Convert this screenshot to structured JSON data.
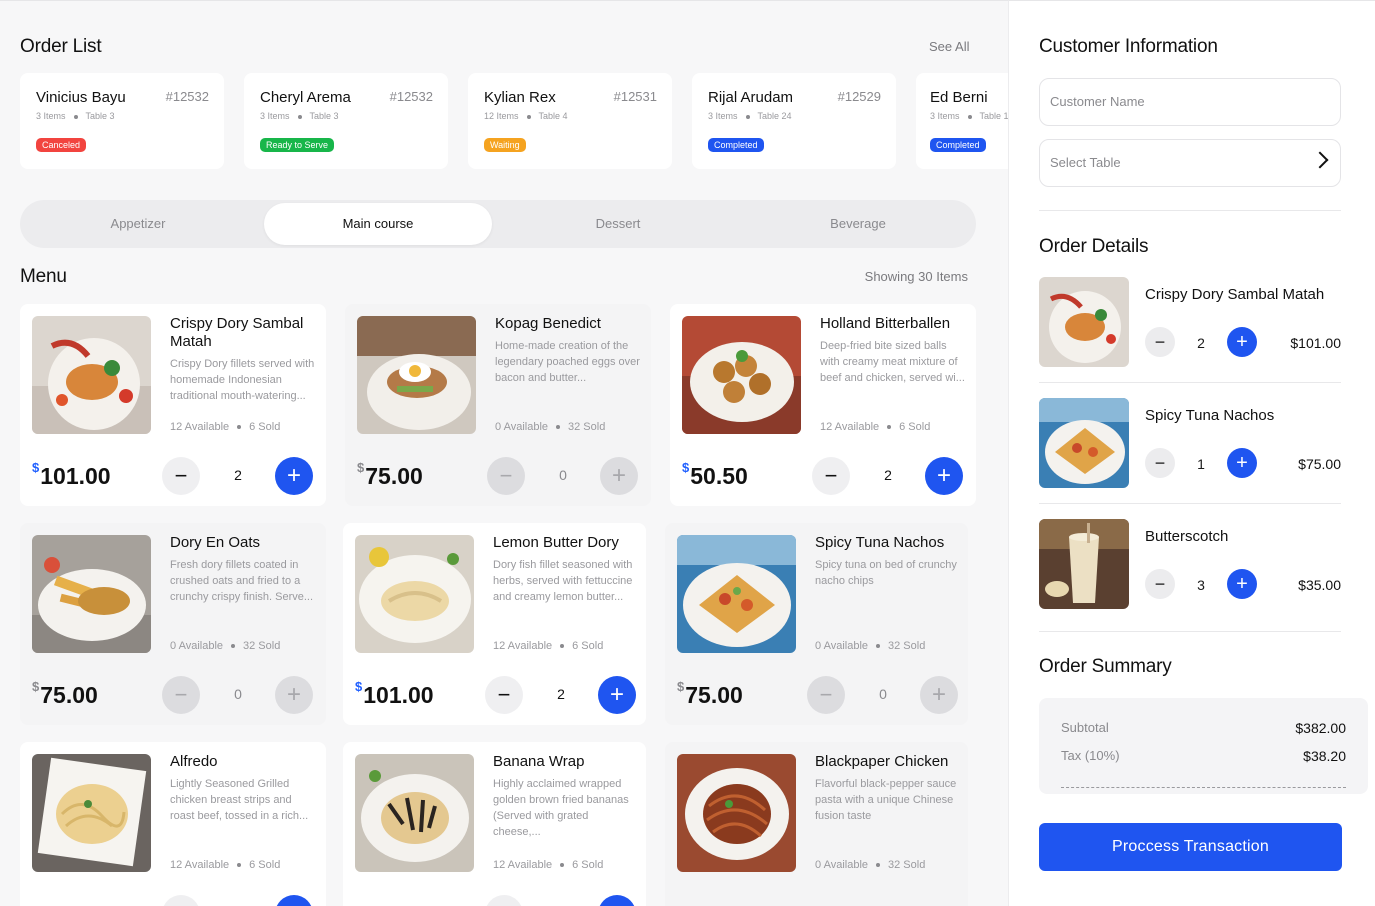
{
  "orders": {
    "title": "Order List",
    "see_all": "See All",
    "items": [
      {
        "name": "Vinicius Bayu",
        "number": "#12532",
        "items": "3 Items",
        "table": "Table 3",
        "status": "Canceled",
        "status_color": "#f2443f"
      },
      {
        "name": "Cheryl Arema",
        "number": "#12532",
        "items": "3 Items",
        "table": "Table 3",
        "status": "Ready to Serve",
        "status_color": "#18b64a"
      },
      {
        "name": "Kylian Rex",
        "number": "#12531",
        "items": "12 Items",
        "table": "Table 4",
        "status": "Waiting",
        "status_color": "#f5a320"
      },
      {
        "name": "Rijal Arudam",
        "number": "#12529",
        "items": "3 Items",
        "table": "Table 24",
        "status": "Completed",
        "status_color": "#1f55f0"
      },
      {
        "name": "Ed Berni",
        "number": "",
        "items": "3 Items",
        "table": "Table 1",
        "status": "Completed",
        "status_color": "#1f55f0"
      }
    ]
  },
  "tabs": [
    "Appetizer",
    "Main course",
    "Dessert",
    "Beverage"
  ],
  "menu": {
    "title": "Menu",
    "showing": "Showing 30 Items",
    "items": [
      {
        "name": "Crispy Dory Sambal Matah",
        "desc": "Crispy Dory fillets served with homemade Indonesian traditional mouth-watering...",
        "available": "12 Available",
        "sold": "6 Sold",
        "currency": "$",
        "price": "101.00",
        "qty": "2"
      },
      {
        "name": "Kopag Benedict",
        "desc": "Home-made creation of the legendary poached eggs over bacon and butter...",
        "available": "0 Available",
        "sold": "32 Sold",
        "currency": "$",
        "price": "75.00",
        "qty": "0"
      },
      {
        "name": "Holland Bitterballen",
        "desc": "Deep-fried bite sized balls with creamy meat mixture of beef and chicken, served wi...",
        "available": "12 Available",
        "sold": "6 Sold",
        "currency": "$",
        "price": "50.50",
        "qty": "2"
      },
      {
        "name": "Dory En Oats",
        "desc": "Fresh dory fillets coated in crushed oats and fried to a crunchy crispy finish. Serve...",
        "available": "0 Available",
        "sold": "32 Sold",
        "currency": "$",
        "price": "75.00",
        "qty": "0"
      },
      {
        "name": "Lemon Butter Dory",
        "desc": "Dory fish fillet seasoned with herbs, served with fettuccine and creamy lemon butter...",
        "available": "12 Available",
        "sold": "6 Sold",
        "currency": "$",
        "price": "101.00",
        "qty": "2"
      },
      {
        "name": "Spicy Tuna Nachos",
        "desc": "Spicy tuna on bed of crunchy nacho chips",
        "available": "0 Available",
        "sold": "32 Sold",
        "currency": "$",
        "price": "75.00",
        "qty": "0"
      },
      {
        "name": "Alfredo",
        "desc": "Lightly Seasoned Grilled chicken breast strips and roast beef, tossed in a rich...",
        "available": "12 Available",
        "sold": "6 Sold"
      },
      {
        "name": "Banana Wrap",
        "desc": "Highly acclaimed wrapped golden brown fried bananas (Served with grated cheese,...",
        "available": "12 Available",
        "sold": "6 Sold"
      },
      {
        "name": "Blackpaper Chicken",
        "desc": "Flavorful black-pepper sauce pasta with a unique Chinese fusion taste",
        "available": "0 Available",
        "sold": "32 Sold"
      }
    ]
  },
  "customer": {
    "title": "Customer Information",
    "name_placeholder": "Customer Name",
    "table_placeholder": "Select Table"
  },
  "order_details": {
    "title": "Order Details",
    "items": [
      {
        "name": "Crispy Dory Sambal Matah",
        "qty": "2",
        "price": "$101.00"
      },
      {
        "name": "Spicy Tuna Nachos",
        "qty": "1",
        "price": "$75.00"
      },
      {
        "name": "Butterscotch",
        "qty": "3",
        "price": "$35.00"
      }
    ]
  },
  "summary": {
    "title": "Order Summary",
    "subtotal_label": "Subtotal",
    "subtotal": "$382.00",
    "tax_label": "Tax (10%)",
    "tax": "$38.20"
  },
  "actions": {
    "process": "Proccess Transaction"
  },
  "icons": {
    "minus": "minus-icon",
    "plus": "plus-icon",
    "chevron": "chevron-right-icon"
  },
  "colors": {
    "accent": "#1f55f0"
  }
}
